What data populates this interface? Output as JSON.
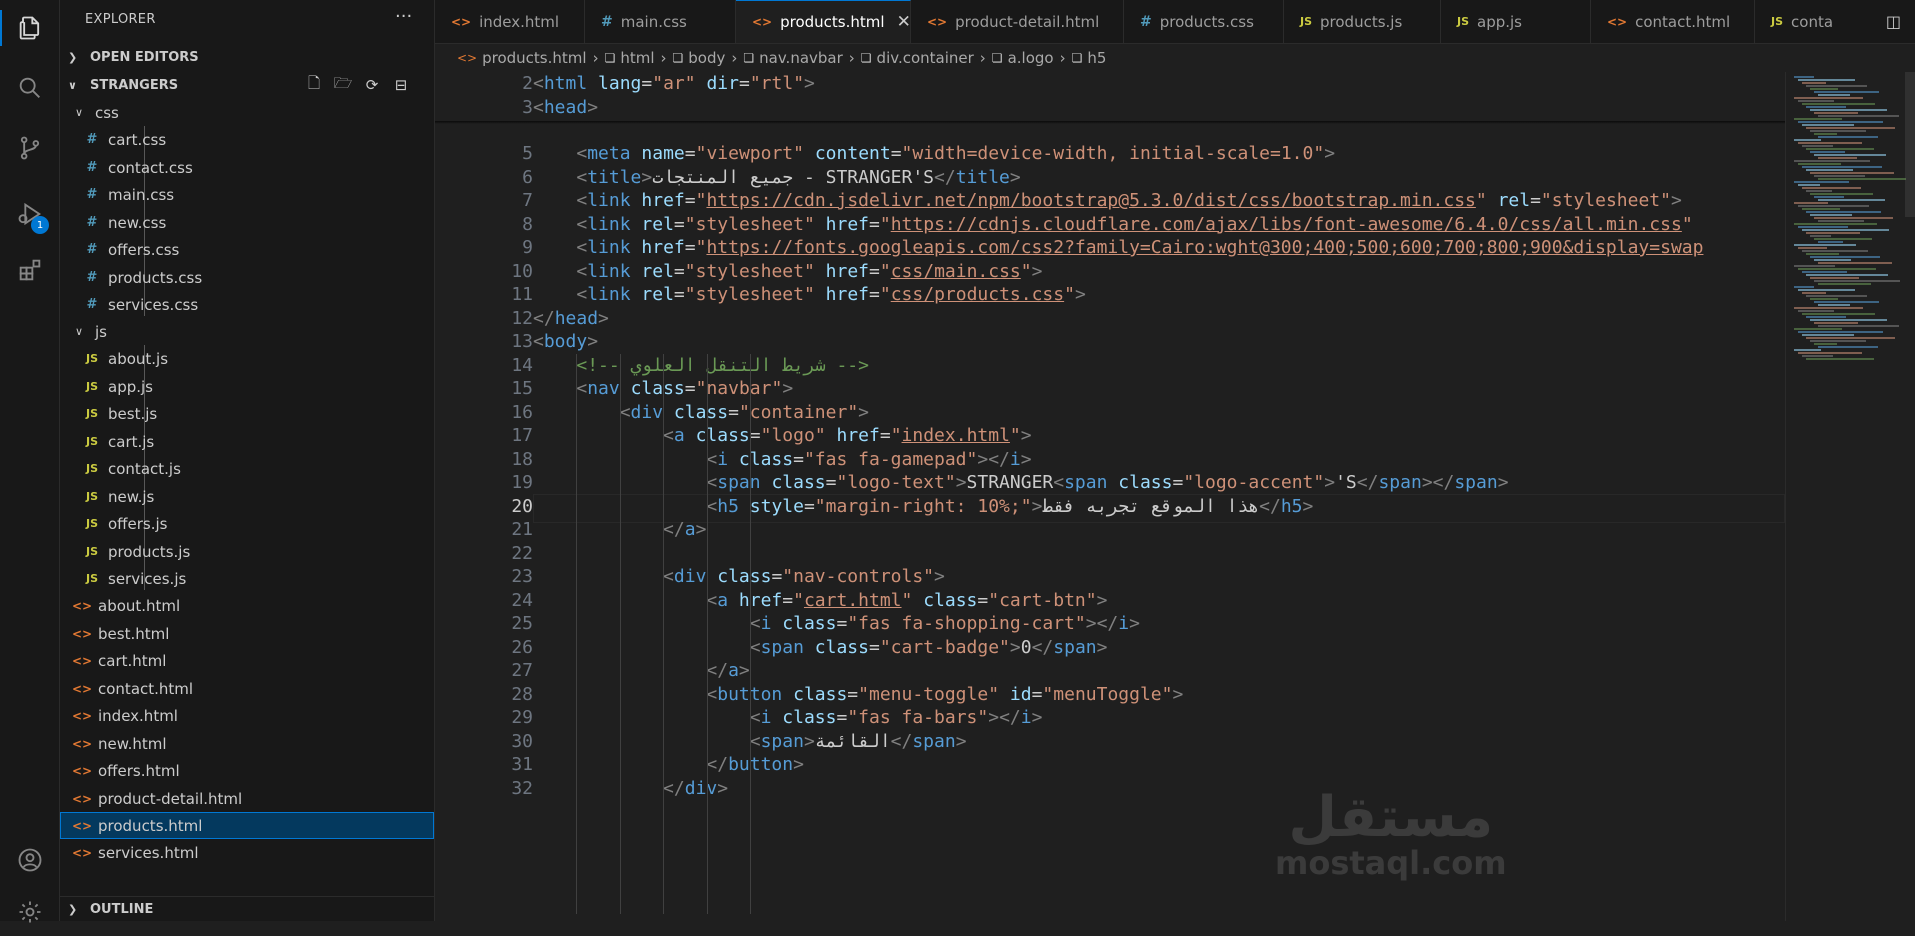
{
  "activity_bar": {
    "icons": [
      "explorer-icon",
      "search-icon",
      "source-control-icon",
      "run-debug-icon",
      "extensions-icon",
      "account-icon",
      "settings-icon"
    ],
    "debug_badge": "1"
  },
  "sidebar": {
    "title": "EXPLORER",
    "more": "···",
    "open_editors": "OPEN EDITORS",
    "project": "STRANGERS",
    "outline": "OUTLINE",
    "folders": {
      "css": {
        "name": "css",
        "files": [
          "cart.css",
          "contact.css",
          "main.css",
          "new.css",
          "offers.css",
          "products.css",
          "services.css"
        ]
      },
      "js": {
        "name": "js",
        "files": [
          "about.js",
          "app.js",
          "best.js",
          "cart.js",
          "contact.js",
          "new.js",
          "offers.js",
          "products.js",
          "services.js"
        ]
      }
    },
    "html_files": [
      "about.html",
      "best.html",
      "cart.html",
      "contact.html",
      "index.html",
      "new.html",
      "offers.html",
      "product-detail.html",
      "products.html",
      "services.html"
    ],
    "selected_file": "products.html"
  },
  "tabs": [
    {
      "label": "index.html",
      "type": "html"
    },
    {
      "label": "main.css",
      "type": "css"
    },
    {
      "label": "products.html",
      "type": "html",
      "active": true
    },
    {
      "label": "product-detail.html",
      "type": "html"
    },
    {
      "label": "products.css",
      "type": "css"
    },
    {
      "label": "products.js",
      "type": "js"
    },
    {
      "label": "app.js",
      "type": "js"
    },
    {
      "label": "contact.html",
      "type": "html"
    },
    {
      "label": "conta",
      "type": "js"
    }
  ],
  "breadcrumb": [
    "products.html",
    "html",
    "body",
    "nav.navbar",
    "div.container",
    "a.logo",
    "h5"
  ],
  "editor": {
    "current_line": "20",
    "lines": [
      {
        "n": "2",
        "code": "<html lang=\"ar\" dir=\"rtl\">"
      },
      {
        "n": "3",
        "code": "<head>"
      },
      {
        "n": "5",
        "code": "    <meta name=\"viewport\" content=\"width=device-width, initial-scale=1.0\">"
      },
      {
        "n": "6",
        "code": "    <title>جميع المنتجات - STRANGER'S</title>"
      },
      {
        "n": "7",
        "code": "    <link href=\"https://cdn.jsdelivr.net/npm/bootstrap@5.3.0/dist/css/bootstrap.min.css\" rel=\"stylesheet\">"
      },
      {
        "n": "8",
        "code": "    <link rel=\"stylesheet\" href=\"https://cdnjs.cloudflare.com/ajax/libs/font-awesome/6.4.0/css/all.min.css\""
      },
      {
        "n": "9",
        "code": "    <link href=\"https://fonts.googleapis.com/css2?family=Cairo:wght@300;400;500;600;700;800;900&display=swap"
      },
      {
        "n": "10",
        "code": "    <link rel=\"stylesheet\" href=\"css/main.css\">"
      },
      {
        "n": "11",
        "code": "    <link rel=\"stylesheet\" href=\"css/products.css\">"
      },
      {
        "n": "12",
        "code": "</head>"
      },
      {
        "n": "13",
        "code": "<body>"
      },
      {
        "n": "14",
        "code": "    <!-- شريط التنقل العلوي -->"
      },
      {
        "n": "15",
        "code": "    <nav class=\"navbar\">"
      },
      {
        "n": "16",
        "code": "        <div class=\"container\">"
      },
      {
        "n": "17",
        "code": "            <a class=\"logo\" href=\"index.html\">"
      },
      {
        "n": "18",
        "code": "                <i class=\"fas fa-gamepad\"></i>"
      },
      {
        "n": "19",
        "code": "                <span class=\"logo-text\">STRANGER<span class=\"logo-accent\">'S</span></span>"
      },
      {
        "n": "20",
        "code": "                <h5 style=\"margin-right: 10%;\">هذا الموقع تجربه فقط</h5>"
      },
      {
        "n": "21",
        "code": "            </a>"
      },
      {
        "n": "22",
        "code": ""
      },
      {
        "n": "23",
        "code": "            <div class=\"nav-controls\">"
      },
      {
        "n": "24",
        "code": "                <a href=\"cart.html\" class=\"cart-btn\">"
      },
      {
        "n": "25",
        "code": "                    <i class=\"fas fa-shopping-cart\"></i>"
      },
      {
        "n": "26",
        "code": "                    <span class=\"cart-badge\">0</span>"
      },
      {
        "n": "27",
        "code": "                </a>"
      },
      {
        "n": "28",
        "code": "                <button class=\"menu-toggle\" id=\"menuToggle\">"
      },
      {
        "n": "29",
        "code": "                    <i class=\"fas fa-bars\"></i>"
      },
      {
        "n": "30",
        "code": "                    <span>القائمة</span>"
      },
      {
        "n": "31",
        "code": "                </button>"
      },
      {
        "n": "32",
        "code": "            </div>"
      }
    ]
  },
  "watermark": {
    "arabic": "مستقل",
    "latin": "mostaql.com"
  },
  "colors": {
    "accent": "#0078d4",
    "tag": "#569cd6",
    "attr": "#9cdcfe",
    "string": "#ce9178",
    "comment": "#6a9955"
  }
}
